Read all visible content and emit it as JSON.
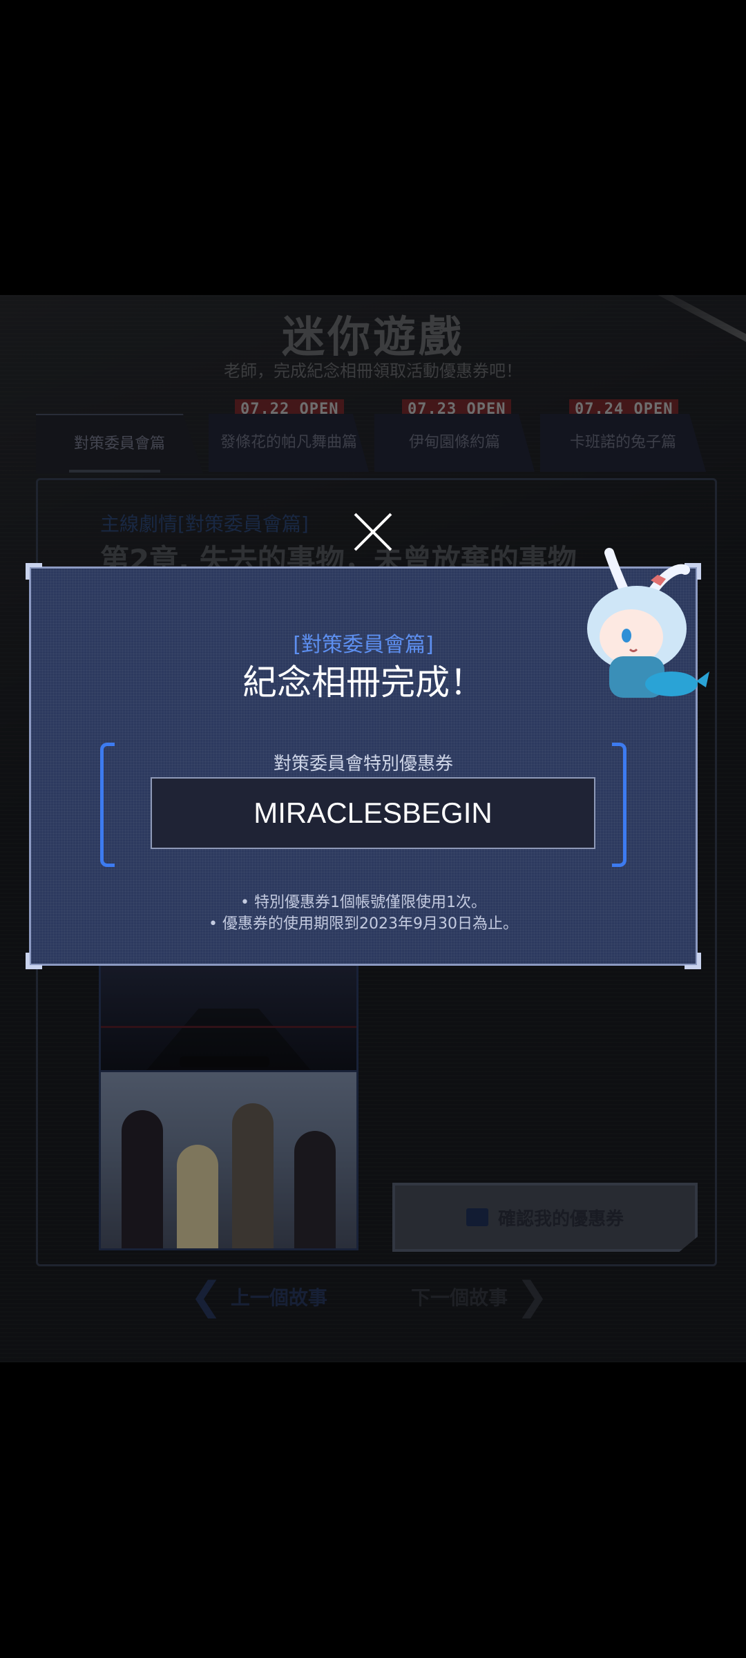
{
  "background": {
    "title": "迷你遊戲",
    "subtitle": "老師，完成紀念相冊領取活動優惠券吧！",
    "tabs": [
      {
        "label": "對策委員會篇",
        "open_tag": ""
      },
      {
        "label": "發條花的帕凡舞曲篇",
        "open_tag": "07.22 OPEN"
      },
      {
        "label": "伊甸園條約篇",
        "open_tag": "07.23 OPEN"
      },
      {
        "label": "卡班諾的兔子篇",
        "open_tag": "07.24 OPEN"
      }
    ],
    "chapter_label": "主線劇情[對策委員會篇]",
    "chapter_title": "第2章. 失去的事物，未曾放棄的事物",
    "check_coupon_button": "確認我的優惠券",
    "prev_story": "上一個故事",
    "next_story": "下一個故事"
  },
  "modal": {
    "tag": "[對策委員會篇]",
    "title": "紀念相冊完成！",
    "coupon_label": "對策委員會特別優惠券",
    "coupon_code": "MIRACLESBEGIN",
    "notes": [
      "• 特別優惠券1個帳號僅限使用1次。",
      "• 優惠券的使用期限到2023年9月30日為止。"
    ],
    "close_icon": "close-icon"
  },
  "colors": {
    "accent_blue": "#3d7bf0",
    "modal_bg": "#2d3a5f",
    "open_tag_red": "#7a2a2f"
  }
}
